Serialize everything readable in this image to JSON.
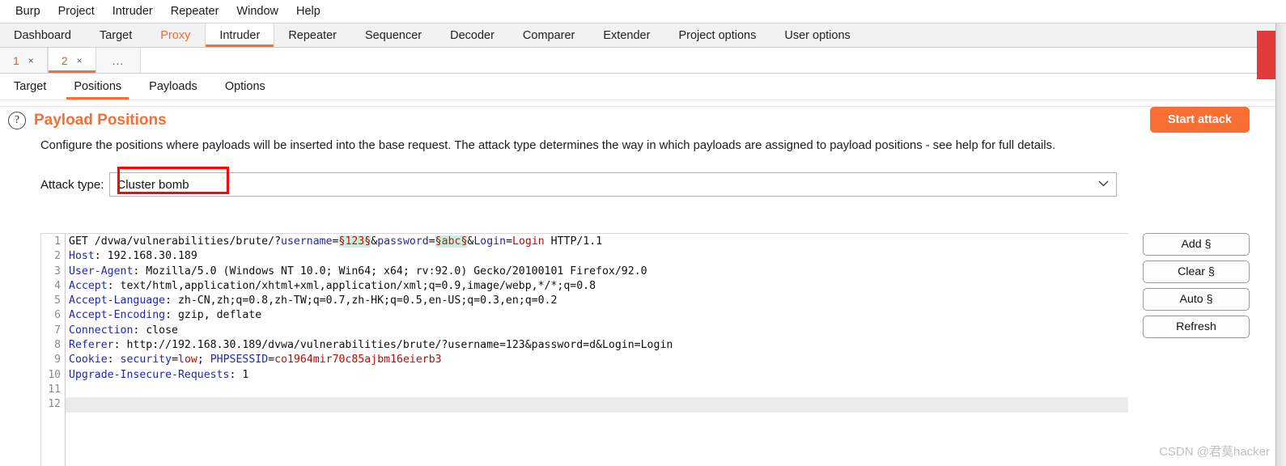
{
  "menubar": {
    "items": [
      {
        "label": "Burp"
      },
      {
        "label": "Project"
      },
      {
        "label": "Intruder"
      },
      {
        "label": "Repeater"
      },
      {
        "label": "Window"
      },
      {
        "label": "Help"
      }
    ]
  },
  "main_tabs": {
    "active": "Intruder",
    "accent_color": "#f96e33",
    "items": [
      {
        "label": "Dashboard"
      },
      {
        "label": "Target"
      },
      {
        "label": "Proxy"
      },
      {
        "label": "Intruder"
      },
      {
        "label": "Repeater"
      },
      {
        "label": "Sequencer"
      },
      {
        "label": "Decoder"
      },
      {
        "label": "Comparer"
      },
      {
        "label": "Extender"
      },
      {
        "label": "Project options"
      },
      {
        "label": "User options"
      }
    ]
  },
  "attack_tabs": {
    "active": "2",
    "items": [
      {
        "label": "1",
        "close": "×"
      },
      {
        "label": "2",
        "close": "×"
      }
    ],
    "more": "..."
  },
  "sub_tabs": {
    "active": "Positions",
    "items": [
      {
        "label": "Target"
      },
      {
        "label": "Positions"
      },
      {
        "label": "Payloads"
      },
      {
        "label": "Options"
      }
    ]
  },
  "panel": {
    "help_icon": "?",
    "title": "Payload Positions",
    "description": "Configure the positions where payloads will be inserted into the base request. The attack type determines the way in which payloads are assigned to payload positions - see help for full details.",
    "start_attack_label": "Start attack"
  },
  "attack_type": {
    "label": "Attack type:",
    "value": "Cluster bomb",
    "chevron": "⌄",
    "highlight_color": "#fb0606"
  },
  "request": {
    "line_numbers": [
      "1",
      "2",
      "3",
      "4",
      "5",
      "6",
      "7",
      "8",
      "9",
      "10",
      "11",
      "12"
    ],
    "cursor_line": 12,
    "lines": [
      {
        "n": 1,
        "segments": [
          {
            "t": "GET /dvwa/vulnerabilities/brute/?",
            "c": "val"
          },
          {
            "t": "username",
            "c": "hdr"
          },
          {
            "t": "=",
            "c": "val"
          },
          {
            "t": "§",
            "c": "mark"
          },
          {
            "t": "123",
            "c": "marktxt"
          },
          {
            "t": "§",
            "c": "mark"
          },
          {
            "t": "&",
            "c": "val"
          },
          {
            "t": "password",
            "c": "hdr"
          },
          {
            "t": "=",
            "c": "val"
          },
          {
            "t": "§",
            "c": "mark"
          },
          {
            "t": "abc",
            "c": "marktxt"
          },
          {
            "t": "§",
            "c": "mark"
          },
          {
            "t": "&",
            "c": "val"
          },
          {
            "t": "Login",
            "c": "hdr"
          },
          {
            "t": "=",
            "c": "val"
          },
          {
            "t": "Login",
            "c": "red"
          },
          {
            "t": " HTTP/1.1",
            "c": "val"
          }
        ]
      },
      {
        "n": 2,
        "segments": [
          {
            "t": "Host",
            "c": "hdr"
          },
          {
            "t": ": 192.168.30.189",
            "c": "val"
          }
        ]
      },
      {
        "n": 3,
        "segments": [
          {
            "t": "User-Agent",
            "c": "hdr"
          },
          {
            "t": ": Mozilla/5.0 (Windows NT 10.0; Win64; x64; rv:92.0) Gecko/20100101 Firefox/92.0",
            "c": "val"
          }
        ]
      },
      {
        "n": 4,
        "segments": [
          {
            "t": "Accept",
            "c": "hdr"
          },
          {
            "t": ": text/html,application/xhtml+xml,application/xml;q=0.9,image/webp,*/*;q=0.8",
            "c": "val"
          }
        ]
      },
      {
        "n": 5,
        "segments": [
          {
            "t": "Accept-Language",
            "c": "hdr"
          },
          {
            "t": ": zh-CN,zh;q=0.8,zh-TW;q=0.7,zh-HK;q=0.5,en-US;q=0.3,en;q=0.2",
            "c": "val"
          }
        ]
      },
      {
        "n": 6,
        "segments": [
          {
            "t": "Accept-Encoding",
            "c": "hdr"
          },
          {
            "t": ": gzip, deflate",
            "c": "val"
          }
        ]
      },
      {
        "n": 7,
        "segments": [
          {
            "t": "Connection",
            "c": "hdr"
          },
          {
            "t": ": close",
            "c": "val"
          }
        ]
      },
      {
        "n": 8,
        "segments": [
          {
            "t": "Referer",
            "c": "hdr"
          },
          {
            "t": ": http://192.168.30.189/dvwa/vulnerabilities/brute/?username=123&password=d&Login=Login",
            "c": "val"
          }
        ]
      },
      {
        "n": 9,
        "segments": [
          {
            "t": "Cookie",
            "c": "hdr"
          },
          {
            "t": ": ",
            "c": "val"
          },
          {
            "t": "security",
            "c": "hdr"
          },
          {
            "t": "=",
            "c": "val"
          },
          {
            "t": "low",
            "c": "red"
          },
          {
            "t": "; ",
            "c": "val"
          },
          {
            "t": "PHPSESSID",
            "c": "hdr"
          },
          {
            "t": "=",
            "c": "val"
          },
          {
            "t": "co1964mir70c85ajbm16eierb3",
            "c": "red"
          }
        ]
      },
      {
        "n": 10,
        "segments": [
          {
            "t": "Upgrade-Insecure-Requests",
            "c": "hdr"
          },
          {
            "t": ": 1",
            "c": "val"
          }
        ]
      },
      {
        "n": 11,
        "segments": []
      },
      {
        "n": 12,
        "segments": []
      }
    ]
  },
  "side_buttons": [
    {
      "label": "Add §"
    },
    {
      "label": "Clear §"
    },
    {
      "label": "Auto §"
    },
    {
      "label": "Refresh"
    }
  ],
  "watermark": "CSDN @君莫hacker"
}
